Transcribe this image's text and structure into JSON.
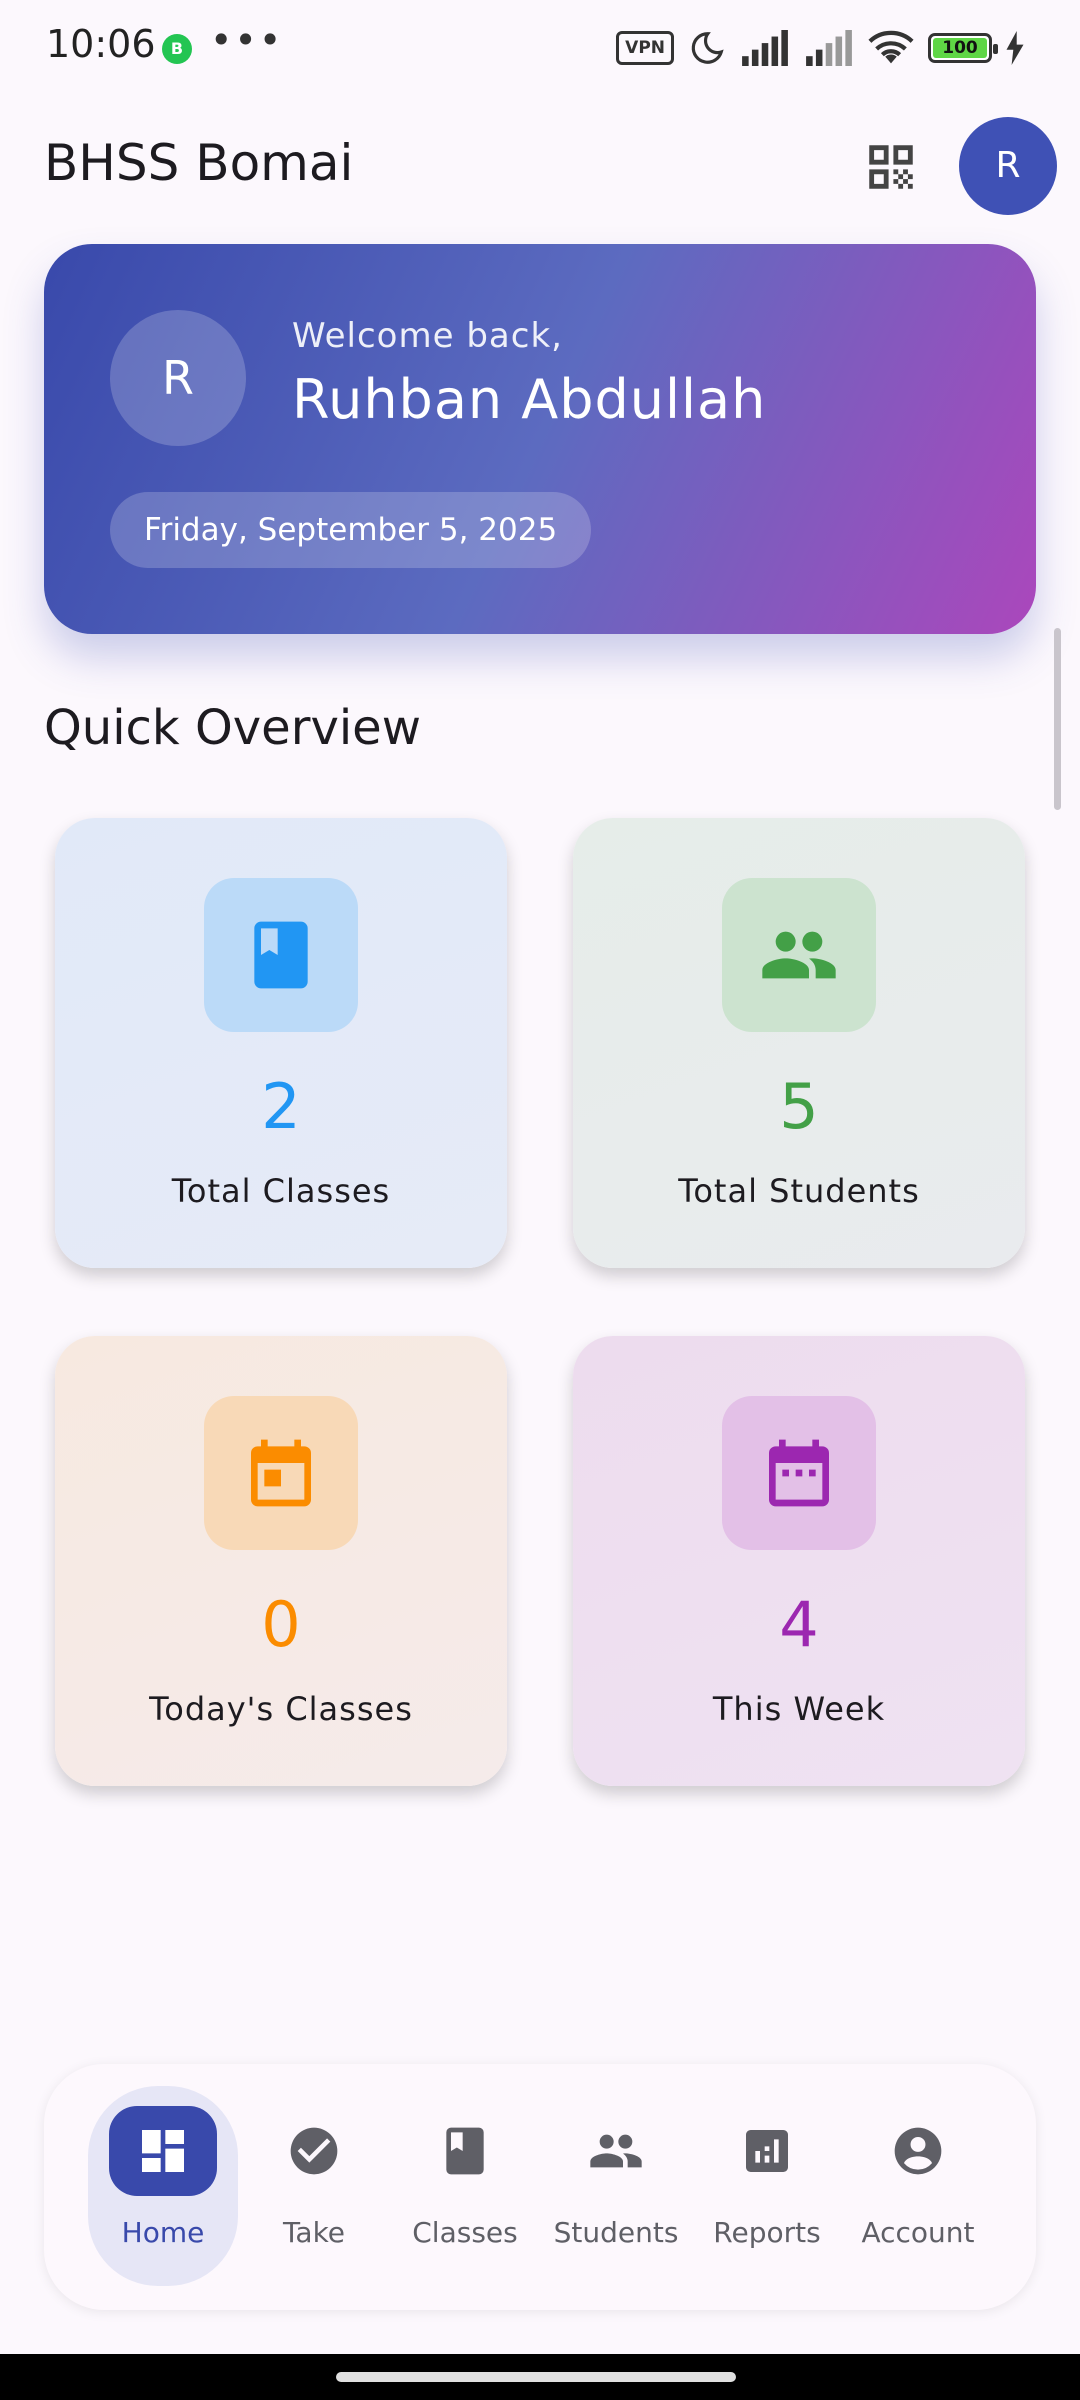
{
  "status_bar": {
    "time": "10:06",
    "notification_badge": "B",
    "more": "•••",
    "vpn": "VPN",
    "battery": "100",
    "battery_level": 1.0
  },
  "app_bar": {
    "title": "BHSS Bomai",
    "qr_icon": "qr-code-icon",
    "avatar_initial": "R"
  },
  "welcome": {
    "avatar_initial": "R",
    "greeting": "Welcome back,",
    "name": "Ruhban Abdullah",
    "date": "Friday, September 5, 2025"
  },
  "overview": {
    "title": "Quick Overview",
    "cards": [
      {
        "value": "2",
        "label": "Total Classes",
        "icon": "book-icon",
        "color": "#2196f3",
        "icon_bg": "#bbdaf8"
      },
      {
        "value": "5",
        "label": "Total Students",
        "icon": "people-icon",
        "color": "#43a047",
        "icon_bg": "#cce3cf"
      },
      {
        "value": "0",
        "label": "Today's Classes",
        "icon": "calendar-today-icon",
        "color": "#fb8c00",
        "icon_bg": "#f8d9b7"
      },
      {
        "value": "4",
        "label": "This Week",
        "icon": "calendar-week-icon",
        "color": "#9c27b0",
        "icon_bg": "#e3c0e7"
      }
    ]
  },
  "bottom_nav": {
    "active": "Home",
    "items": [
      {
        "label": "Home",
        "icon": "dashboard-icon"
      },
      {
        "label": "Take",
        "icon": "check-circle-icon"
      },
      {
        "label": "Classes",
        "icon": "book-icon"
      },
      {
        "label": "Students",
        "icon": "people-icon"
      },
      {
        "label": "Reports",
        "icon": "analytics-icon"
      },
      {
        "label": "Account",
        "icon": "account-circle-icon"
      }
    ]
  },
  "colors": {
    "primary": "#3f51b5",
    "background": "#fcf8fd"
  }
}
